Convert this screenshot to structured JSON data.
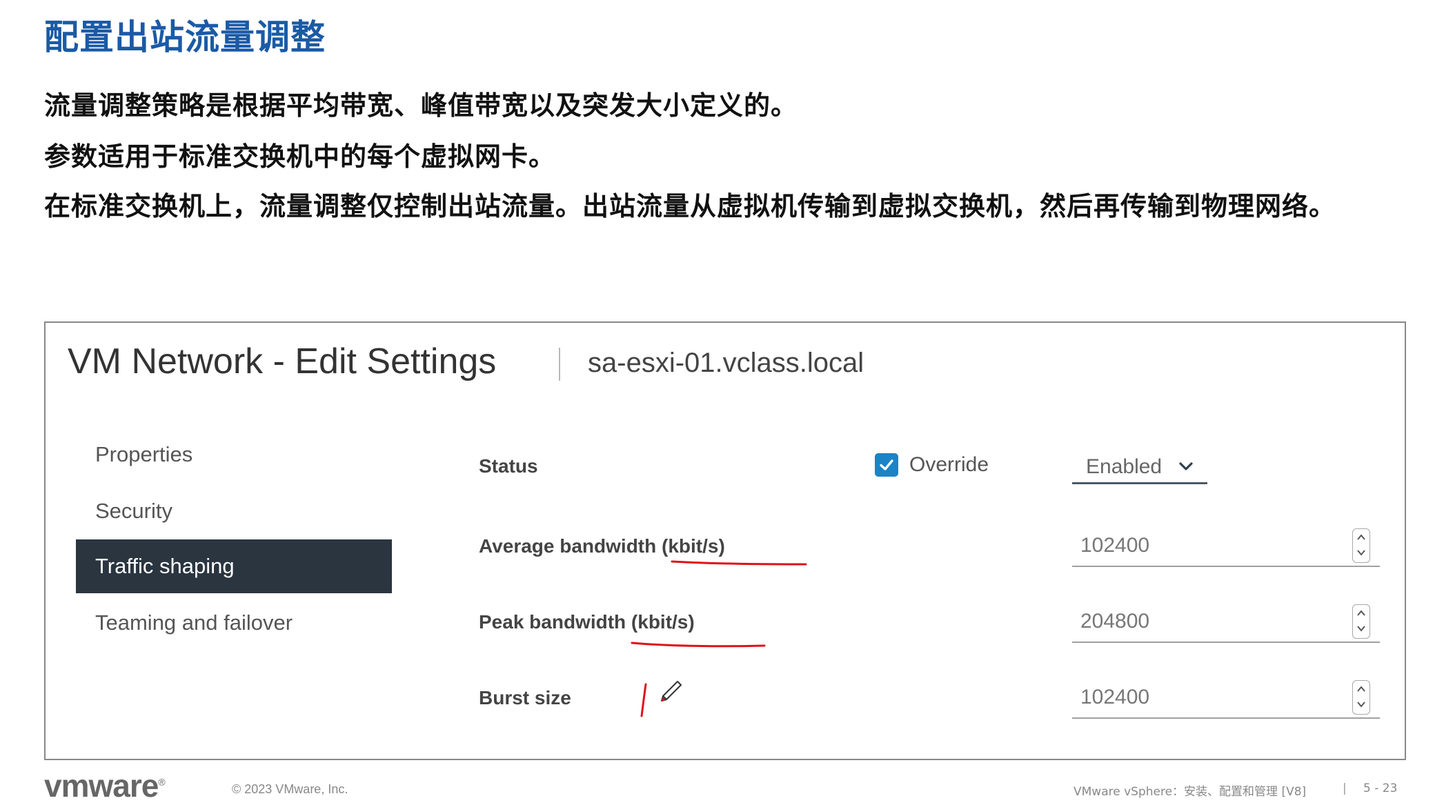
{
  "slide": {
    "title": "配置出站流量调整",
    "bullets": [
      "流量调整策略是根据平均带宽、峰值带宽以及突发大小定义的。",
      "参数适用于标准交换机中的每个虚拟网卡。",
      "在标准交换机上，流量调整仅控制出站流量。出站流量从虚拟机传输到虚拟交换机，然后再传输到物理网络。"
    ]
  },
  "dialog": {
    "title": "VM Network - Edit Settings",
    "host": "sa-esxi-01.vclass.local",
    "nav": [
      {
        "label": "Properties",
        "active": false
      },
      {
        "label": "Security",
        "active": false
      },
      {
        "label": "Traffic shaping",
        "active": true
      },
      {
        "label": "Teaming and failover",
        "active": false
      }
    ],
    "fields": {
      "status": {
        "label": "Status",
        "override_label": "Override",
        "override_checked": true,
        "value": "Enabled"
      },
      "average_bandwidth": {
        "label": "Average bandwidth (kbit/s)",
        "value": "102400"
      },
      "peak_bandwidth": {
        "label": "Peak bandwidth (kbit/s)",
        "value": "204800"
      },
      "burst_size": {
        "label": "Burst size",
        "value": "102400"
      }
    },
    "colors": {
      "nav_active_bg": "#2a3540",
      "checkbox": "#1a84c7",
      "annotation": "#e0101a"
    }
  },
  "footer": {
    "logo": "vmware",
    "copyright": "© 2023 VMware, Inc.",
    "course": "VMware vSphere：安装、配置和管理 [V8]",
    "divider": "|",
    "page": "5 - 23"
  }
}
